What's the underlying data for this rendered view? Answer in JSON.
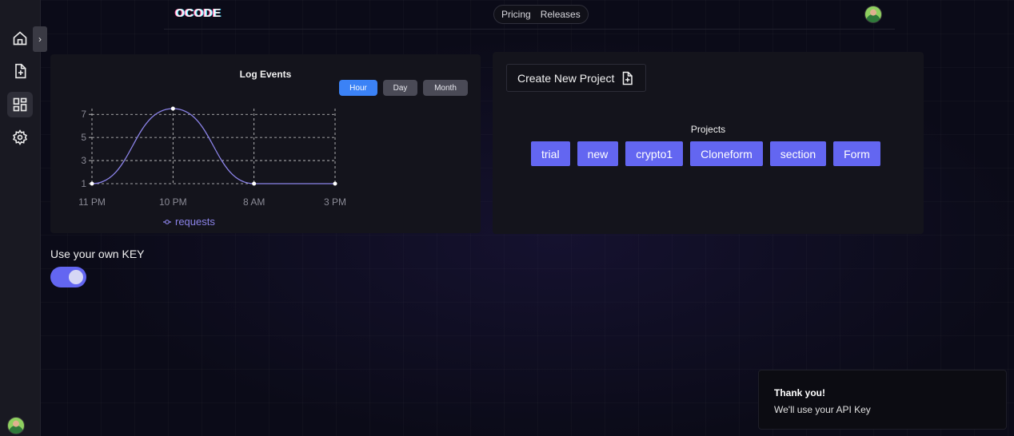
{
  "header": {
    "logo": "OCODE",
    "nav": [
      "Pricing",
      "Releases"
    ]
  },
  "sidebar": {
    "items": [
      {
        "icon": "home-icon"
      },
      {
        "icon": "new-file-icon"
      },
      {
        "icon": "dashboard-icon",
        "active": true
      },
      {
        "icon": "gear-icon"
      }
    ],
    "collapse_label": "›"
  },
  "log_card": {
    "title": "Log Events",
    "ranges": [
      "Hour",
      "Day",
      "Month"
    ],
    "active_range": "Hour"
  },
  "chart_data": {
    "type": "line",
    "x": [
      "11 PM",
      "10 PM",
      "8 AM",
      "3 PM"
    ],
    "y_ticks": [
      1,
      3,
      5,
      7
    ],
    "ylim": [
      1,
      7.5
    ],
    "series": [
      {
        "name": "requests",
        "values": [
          1,
          7.5,
          1,
          1
        ],
        "color": "#8b83e8"
      }
    ],
    "grid": true,
    "legend": "bottom"
  },
  "projects_card": {
    "create_label": "Create New Project",
    "label": "Projects",
    "items": [
      "trial",
      "new",
      "crypto1",
      "Cloneform",
      "section",
      "Form"
    ]
  },
  "key_toggle": {
    "label": "Use your own KEY",
    "on": true
  },
  "toast": {
    "title": "Thank you!",
    "message": "We'll use your API Key"
  },
  "colors": {
    "accent": "#6366f1",
    "active_range": "#3b82f6",
    "line": "#8b83e8"
  }
}
